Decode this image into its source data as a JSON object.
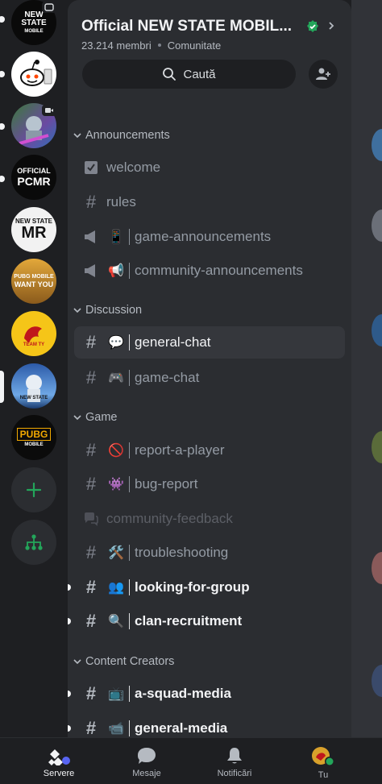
{
  "colors": {
    "background": "#1e1f22",
    "panel": "#2b2d31",
    "accent_green": "#23a55a",
    "blurple": "#5865f2",
    "verified": "#23a55a"
  },
  "servers": [
    {
      "name": "NEW STATE MOBILE",
      "icon_text": "NEW STATE",
      "icon_subtext": "MOBILE"
    },
    {
      "name": "Reddit",
      "icon_text": ""
    },
    {
      "name": "Game server",
      "icon_text": ""
    },
    {
      "name": "Official PCMR",
      "icon_text": "OFFICIAL",
      "icon_subtext": "PCMR"
    },
    {
      "name": "New State MR",
      "icon_text": "NEW STATE",
      "icon_subtext": "MR"
    },
    {
      "name": "PUBG Mobile Want You",
      "icon_text": "PUBG MOBILE",
      "icon_subtext": "WANT YOU"
    },
    {
      "name": "Team TY",
      "icon_text": "TEAM TY"
    },
    {
      "name": "Official NEW STATE MOBILE",
      "icon_text": "NEW STATE"
    },
    {
      "name": "PUBG MOBILE",
      "icon_text": "PUBG",
      "icon_subtext": "MOBILE"
    }
  ],
  "rail": {
    "add_server_icon": "plus-icon",
    "discover_icon": "hub-icon"
  },
  "header": {
    "server_name": "Official NEW STATE MOBIL...",
    "member_count": "23.214 membri",
    "server_type": "Comunitate",
    "search_label": "Caută"
  },
  "categories": [
    {
      "name": "Announcements",
      "channels": [
        {
          "name": "welcome",
          "icon": "rules-icon",
          "emoji": "",
          "state": "normal"
        },
        {
          "name": "rules",
          "icon": "hash-icon",
          "emoji": "",
          "state": "normal"
        },
        {
          "name": "game-announcements",
          "icon": "megaphone-icon",
          "emoji": "📱",
          "state": "normal"
        },
        {
          "name": "community-announcements",
          "icon": "megaphone-icon",
          "emoji": "📢",
          "state": "normal"
        }
      ]
    },
    {
      "name": "Discussion",
      "channels": [
        {
          "name": "general-chat",
          "icon": "hash-icon",
          "emoji": "💬",
          "state": "active"
        },
        {
          "name": "game-chat",
          "icon": "hash-icon",
          "emoji": "🎮",
          "state": "normal"
        }
      ]
    },
    {
      "name": "Game",
      "channels": [
        {
          "name": "report-a-player",
          "icon": "hash-icon",
          "emoji": "🚫",
          "state": "normal"
        },
        {
          "name": "bug-report",
          "icon": "hash-icon",
          "emoji": "👾",
          "state": "normal"
        },
        {
          "name": "community-feedback",
          "icon": "forum-icon",
          "emoji": "",
          "state": "muted"
        },
        {
          "name": "troubleshooting",
          "icon": "hash-icon",
          "emoji": "🛠️",
          "state": "normal"
        },
        {
          "name": "looking-for-group",
          "icon": "hash-icon",
          "emoji": "👥",
          "state": "unread"
        },
        {
          "name": "clan-recruitment",
          "icon": "hash-icon",
          "emoji": "🔍",
          "state": "unread"
        }
      ]
    },
    {
      "name": "Content Creators",
      "channels": [
        {
          "name": "a-squad-media",
          "icon": "hash-icon",
          "emoji": "📺",
          "state": "unread"
        },
        {
          "name": "general-media",
          "icon": "hash-icon",
          "emoji": "📹",
          "state": "unread"
        }
      ]
    }
  ],
  "bottom_nav": [
    {
      "label": "Servere",
      "icon": "servers-icon",
      "active": true
    },
    {
      "label": "Mesaje",
      "icon": "messages-icon",
      "active": false
    },
    {
      "label": "Notificări",
      "icon": "bell-icon",
      "active": false
    },
    {
      "label": "Tu",
      "icon": "avatar-icon",
      "active": false
    }
  ]
}
